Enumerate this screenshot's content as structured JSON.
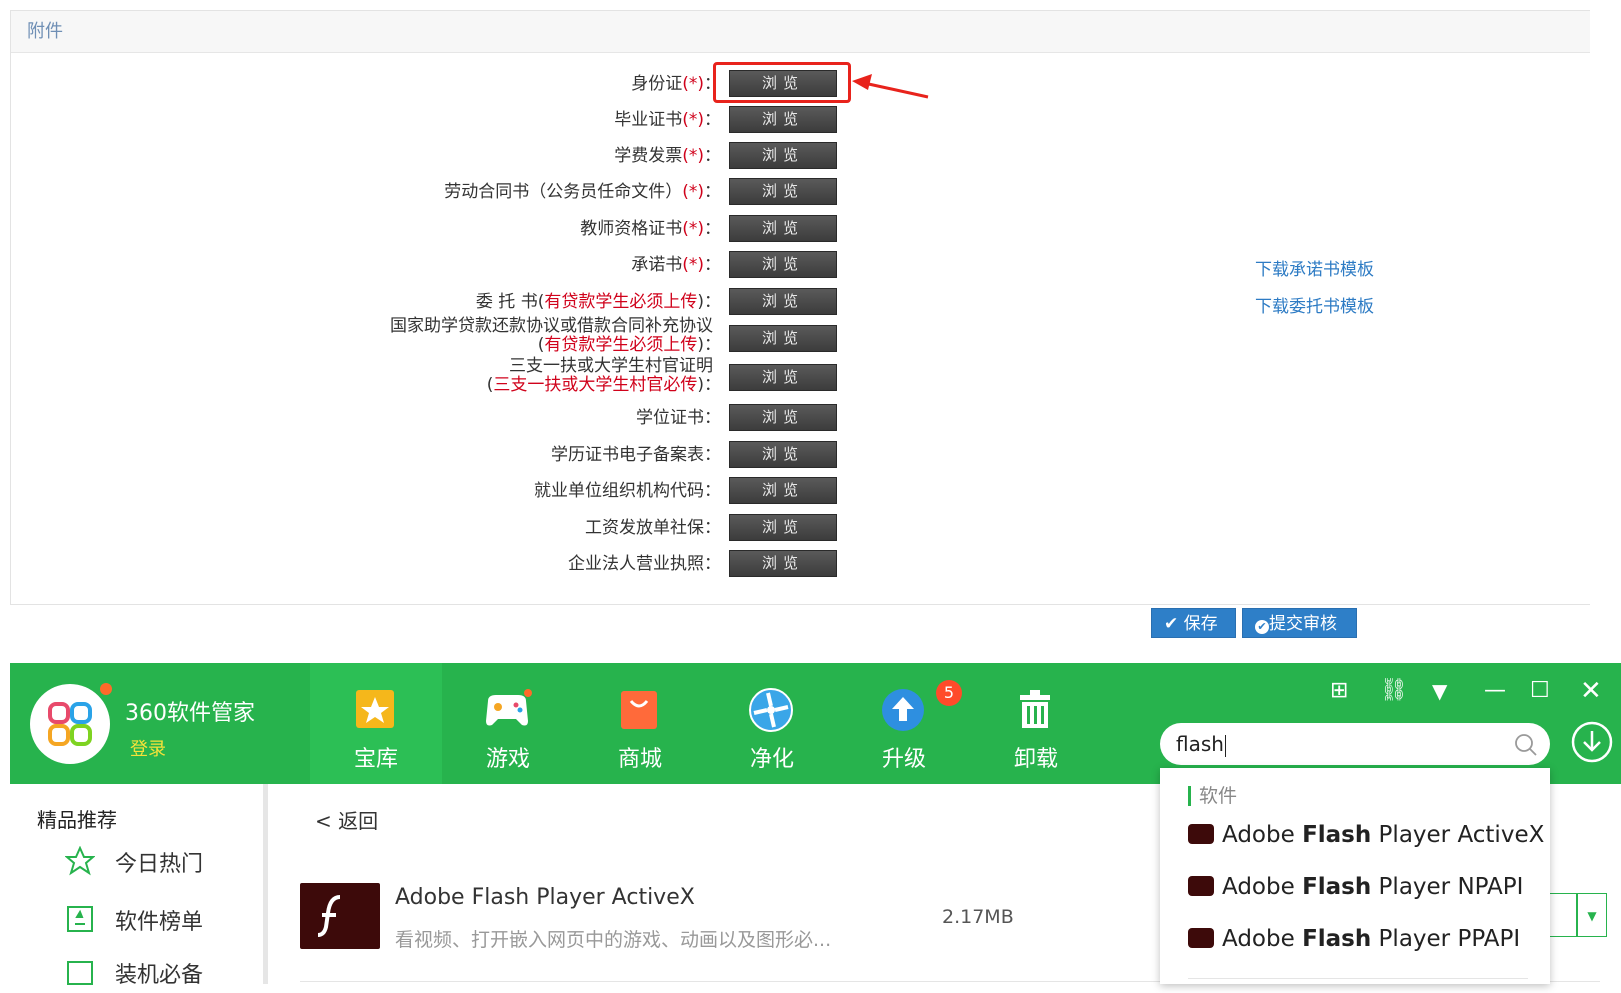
{
  "form": {
    "title": "附件",
    "rows": [
      {
        "label": "身份证",
        "req": "(*)",
        "suffix": "："
      },
      {
        "label": "毕业证书",
        "req": "(*)",
        "suffix": "："
      },
      {
        "label": "学费发票",
        "req": "(*)",
        "suffix": "："
      },
      {
        "label": "劳动合同书（公务员任命文件）",
        "req": "(*)",
        "suffix": "："
      },
      {
        "label": "教师资格证书",
        "req": "(*)",
        "suffix": "："
      },
      {
        "label": "承诺书",
        "req": "(*)",
        "suffix": "："
      },
      {
        "label": "委 托 书(",
        "req": "有贷款学生必须上传",
        "suffix": ")："
      },
      {
        "label": "国家助学贷款还款协议或借款合同补充协议",
        "label2_pre": "(",
        "req": "有贷款学生必须上传",
        "suffix": ")："
      },
      {
        "label": "三支一扶或大学生村官证明",
        "label2_pre": "(",
        "req": "三支一扶或大学生村官必传",
        "suffix": ")："
      },
      {
        "label": "学位证书",
        "req": "",
        "suffix": "："
      },
      {
        "label": "学历证书电子备案表",
        "req": "",
        "suffix": "："
      },
      {
        "label": "就业单位组织机构代码",
        "req": "",
        "suffix": "："
      },
      {
        "label": "工资发放单社保",
        "req": "",
        "suffix": "："
      },
      {
        "label": "企业法人营业执照",
        "req": "",
        "suffix": "："
      }
    ],
    "browse_label": "浏览",
    "links": {
      "promise_template": "下载承诺书模板",
      "entrust_template": "下载委托书模板"
    },
    "save_label": "✔ 保存",
    "submit_label": "提交审核"
  },
  "app": {
    "name": "360软件管家",
    "login": "登录",
    "nav": [
      {
        "label": "宝库",
        "icon": "star-icon"
      },
      {
        "label": "游戏",
        "icon": "gamepad-icon"
      },
      {
        "label": "商城",
        "icon": "shopping-bag-icon"
      },
      {
        "label": "净化",
        "icon": "fan-icon"
      },
      {
        "label": "升级",
        "icon": "upgrade-icon"
      },
      {
        "label": "卸载",
        "icon": "trash-icon"
      }
    ],
    "upgrade_badge": "5",
    "search": {
      "value": "flash"
    },
    "sidebar": {
      "title": "精品推荐",
      "items": [
        "今日热门",
        "软件榜单",
        "装机必备"
      ]
    },
    "back": "< 返回",
    "software": {
      "name": "Adobe Flash Player ActiveX",
      "desc": "看视频、打开嵌入网页中的游戏、动画以及图形必...",
      "size": "2.17MB"
    },
    "dropdown": {
      "heading": "软件",
      "items": [
        {
          "pre": "Adobe ",
          "bold": "Flash",
          "post": " Player ActiveX"
        },
        {
          "pre": "Adobe ",
          "bold": "Flash",
          "post": " Player NPAPI"
        },
        {
          "pre": "Adobe ",
          "bold": "Flash",
          "post": " Player PPAPI"
        }
      ]
    },
    "colors": {
      "brand_green": "#27b34d",
      "link_blue": "#2d7bc4",
      "required_red": "#d0021b"
    }
  }
}
